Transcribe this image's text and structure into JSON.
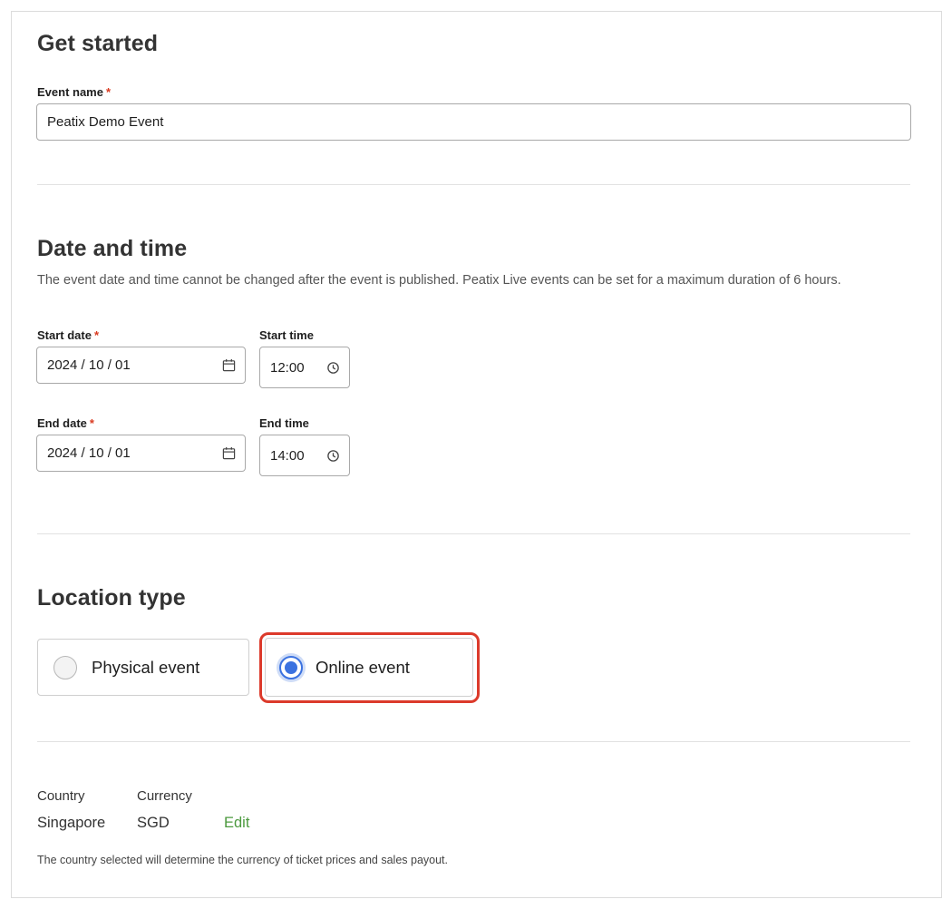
{
  "sections": {
    "get_started": {
      "title": "Get started",
      "event_name": {
        "label": "Event name",
        "required_mark": "*",
        "value": "Peatix Demo Event"
      }
    },
    "date_time": {
      "title": "Date and time",
      "description": "The event date and time cannot be changed after the event is published. Peatix Live events can be set for a maximum duration of 6 hours.",
      "start_date": {
        "label": "Start date",
        "required_mark": "*",
        "value": "2024 / 10 / 01",
        "icon": "calendar-icon"
      },
      "start_time": {
        "label": "Start time",
        "value": "12:00",
        "icon": "clock-icon"
      },
      "end_date": {
        "label": "End date",
        "required_mark": "*",
        "value": "2024 / 10 / 01",
        "icon": "calendar-icon"
      },
      "end_time": {
        "label": "End time",
        "value": "14:00",
        "icon": "clock-icon"
      }
    },
    "location_type": {
      "title": "Location type",
      "options": [
        {
          "label": "Physical event",
          "selected": false
        },
        {
          "label": "Online event",
          "selected": true
        }
      ]
    },
    "region": {
      "country_label": "Country",
      "currency_label": "Currency",
      "country_value": "Singapore",
      "currency_value": "SGD",
      "edit_label": "Edit",
      "note": "The country selected will determine the currency of ticket prices and sales payout."
    }
  },
  "colors": {
    "required": "#d9391f",
    "radio_selected": "#3b72e0",
    "highlight_outline": "#dc3a2b",
    "edit_link": "#4c9a3f"
  }
}
